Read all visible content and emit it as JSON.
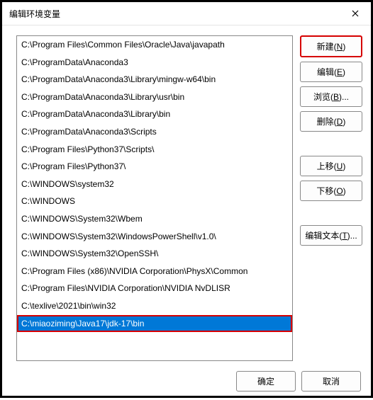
{
  "title": "编辑环境变量",
  "paths": [
    "C:\\Program Files\\Common Files\\Oracle\\Java\\javapath",
    "C:\\ProgramData\\Anaconda3",
    "C:\\ProgramData\\Anaconda3\\Library\\mingw-w64\\bin",
    "C:\\ProgramData\\Anaconda3\\Library\\usr\\bin",
    "C:\\ProgramData\\Anaconda3\\Library\\bin",
    "C:\\ProgramData\\Anaconda3\\Scripts",
    "C:\\Program Files\\Python37\\Scripts\\",
    "C:\\Program Files\\Python37\\",
    "C:\\WINDOWS\\system32",
    "C:\\WINDOWS",
    "C:\\WINDOWS\\System32\\Wbem",
    "C:\\WINDOWS\\System32\\WindowsPowerShell\\v1.0\\",
    "C:\\WINDOWS\\System32\\OpenSSH\\",
    "C:\\Program Files (x86)\\NVIDIA Corporation\\PhysX\\Common",
    "C:\\Program Files\\NVIDIA Corporation\\NVIDIA NvDLISR",
    "C:\\texlive\\2021\\bin\\win32",
    "C:\\miaoziming\\Java17\\jdk-17\\bin"
  ],
  "selected_index": 16,
  "buttons": {
    "new": {
      "label": "新建(",
      "key": "N",
      "suffix": ")"
    },
    "edit": {
      "label": "编辑(",
      "key": "E",
      "suffix": ")"
    },
    "browse": {
      "label": "浏览(",
      "key": "B",
      "suffix": ")..."
    },
    "delete": {
      "label": "删除(",
      "key": "D",
      "suffix": ")"
    },
    "up": {
      "label": "上移(",
      "key": "U",
      "suffix": ")"
    },
    "down": {
      "label": "下移(",
      "key": "O",
      "suffix": ")"
    },
    "edit_text": {
      "label": "编辑文本(",
      "key": "T",
      "suffix": ")..."
    }
  },
  "bottom": {
    "ok": "确定",
    "cancel": "取消"
  }
}
